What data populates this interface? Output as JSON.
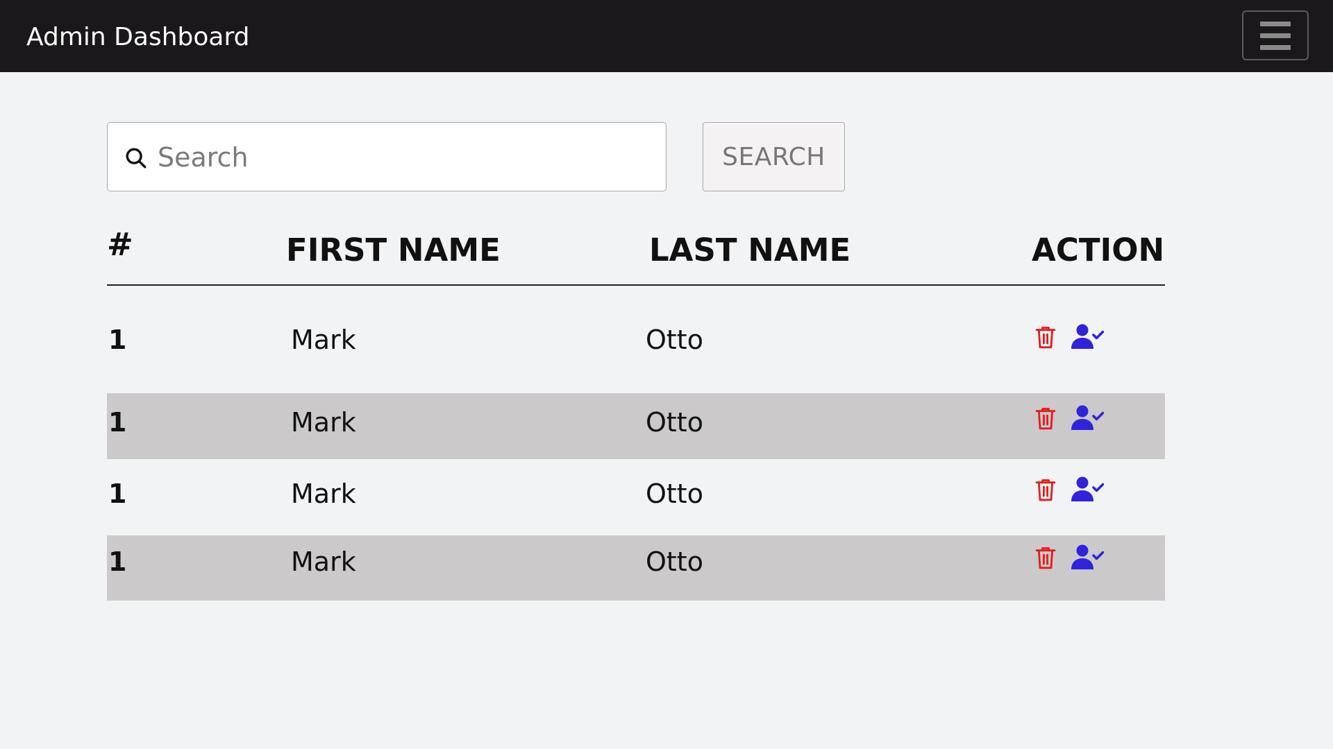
{
  "header": {
    "title": "Admin Dashboard",
    "menu_icon": "hamburger-icon"
  },
  "search": {
    "placeholder": "Search",
    "value": "",
    "icon": "search-icon",
    "button_label": "SEARCH"
  },
  "table": {
    "columns": [
      "#",
      "FIRST NAME",
      "LAST NAME",
      "ACTION"
    ],
    "rows": [
      {
        "num": "1",
        "first": "Mark",
        "last": "Otto"
      },
      {
        "num": "1",
        "first": "Mark",
        "last": "Otto"
      },
      {
        "num": "1",
        "first": "Mark",
        "last": "Otto"
      },
      {
        "num": "1",
        "first": "Mark",
        "last": "Otto"
      }
    ],
    "action_icons": [
      "trash-icon",
      "user-check-icon"
    ]
  },
  "colors": {
    "navbar": "#1a181b",
    "background": "#f2f3f5",
    "row_shade": "#cbc9ca",
    "delete": "#e51b1b",
    "approve": "#2f23dc"
  }
}
